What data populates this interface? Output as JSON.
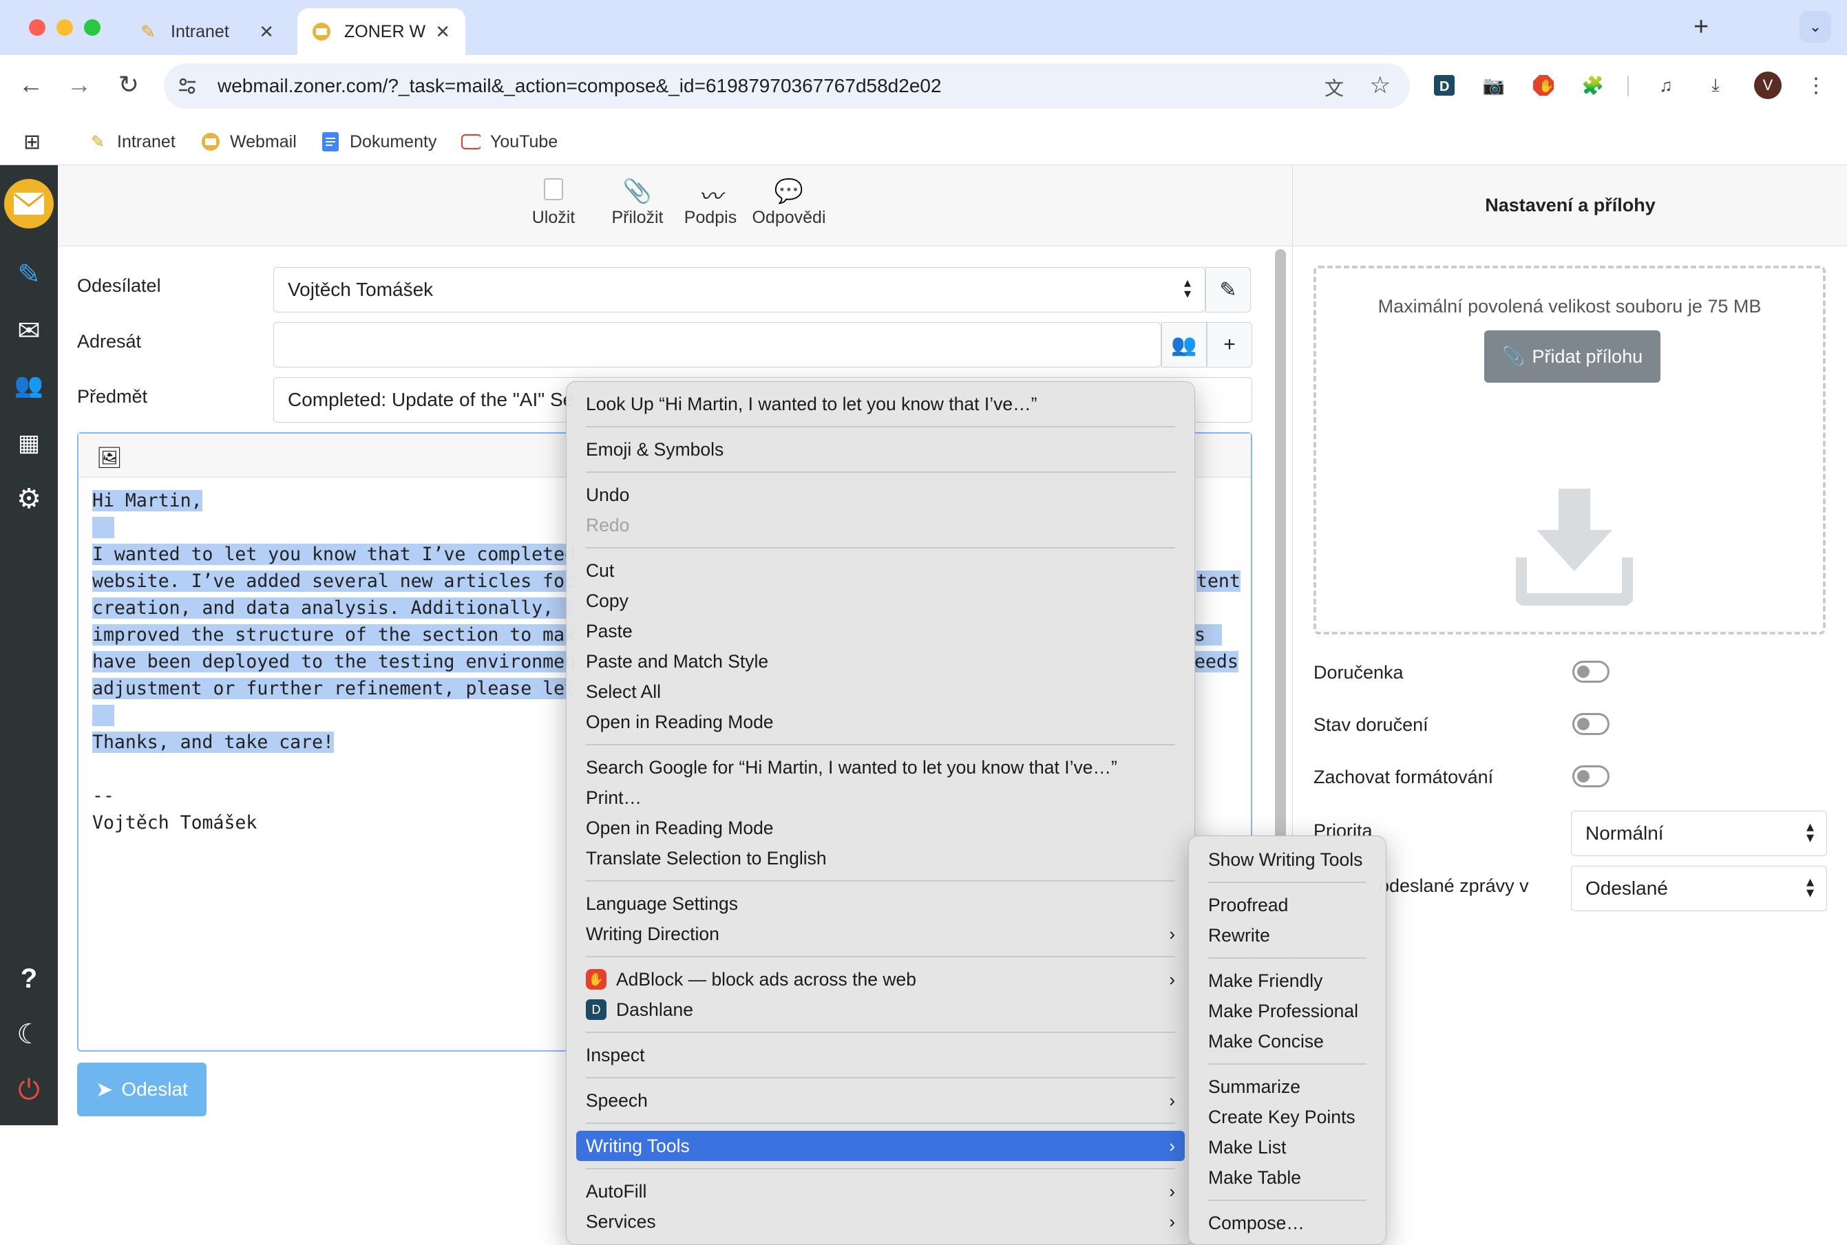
{
  "browser": {
    "tabs": [
      {
        "label": "Intranet"
      },
      {
        "label": "ZONER W"
      }
    ],
    "url": "webmail.zoner.com/?_task=mail&_action=compose&_id=61987970367767d58d2e02",
    "profile_initial": "V",
    "bookmarks": [
      {
        "label": "Intranet"
      },
      {
        "label": "Webmail"
      },
      {
        "label": "Dokumenty"
      },
      {
        "label": "YouTube"
      }
    ]
  },
  "compose_toolbar": {
    "save": "Uložit",
    "attach": "Přiložit",
    "signature": "Podpis",
    "responses": "Odpovědi"
  },
  "form": {
    "sender_label": "Odesílatel",
    "sender_value": "Vojtěch Tomášek",
    "recipient_label": "Adresát",
    "recipient_value": "",
    "subject_label": "Předmět",
    "subject_value": "Completed: Update of the \"AI\" Se"
  },
  "body": {
    "lines": [
      "Hi Martin,",
      "",
      "I wanted to let you know that I’ve completed",
      "website. I’ve added several new articles foc",
      "creation, and data analysis. Additionally, I",
      "improved the structure of the section to mak",
      "have been deployed to the testing environmen",
      "adjustment or further refinement, please let",
      "",
      "Thanks, and take care!",
      "",
      "--",
      "Vojtěch Tomášek"
    ],
    "right_fragments": [
      "tent",
      "s",
      "eeds"
    ]
  },
  "send_button": "Odeslat",
  "right_panel": {
    "title": "Nastavení a přílohy",
    "max_size_text": "Maximální povolená velikost souboru je 75 MB",
    "add_attachment": "Přidat přílohu",
    "options": [
      {
        "label": "Doručenka"
      },
      {
        "label": "Stav doručení"
      },
      {
        "label": "Zachovat formátování"
      }
    ],
    "priority_label": "Priorita",
    "priority_value": "Normální",
    "save_sent_label": "odeslané zprávy v",
    "save_sent_value": "Odeslané"
  },
  "context_menu": {
    "look_up": "Look Up “Hi Martin,  I wanted to let you know that I’ve…”",
    "emoji": "Emoji & Symbols",
    "undo": "Undo",
    "redo": "Redo",
    "cut": "Cut",
    "copy": "Copy",
    "paste": "Paste",
    "paste_match": "Paste and Match Style",
    "select_all": "Select All",
    "reading_mode_1": "Open in Reading Mode",
    "search_google": "Search Google for “Hi Martin,  I wanted to let you know that I’ve…”",
    "print": "Print…",
    "reading_mode_2": "Open in Reading Mode",
    "translate": "Translate Selection to English",
    "language_settings": "Language Settings",
    "writing_direction": "Writing Direction",
    "adblock": "AdBlock — block ads across the web",
    "dashlane": "Dashlane",
    "inspect": "Inspect",
    "speech": "Speech",
    "writing_tools": "Writing Tools",
    "autofill": "AutoFill",
    "services": "Services"
  },
  "writing_tools_menu": {
    "show": "Show Writing Tools",
    "proofread": "Proofread",
    "rewrite": "Rewrite",
    "friendly": "Make Friendly",
    "professional": "Make Professional",
    "concise": "Make Concise",
    "summarize": "Summarize",
    "key_points": "Create Key Points",
    "list": "Make List",
    "table": "Make Table",
    "compose": "Compose…"
  },
  "colors": {
    "tabbar": "#d7e3fc",
    "sidebar": "#2d3436",
    "selection": "#b4cff5",
    "send_button": "#6eb6f0",
    "menu_highlight": "#3a73e0"
  }
}
